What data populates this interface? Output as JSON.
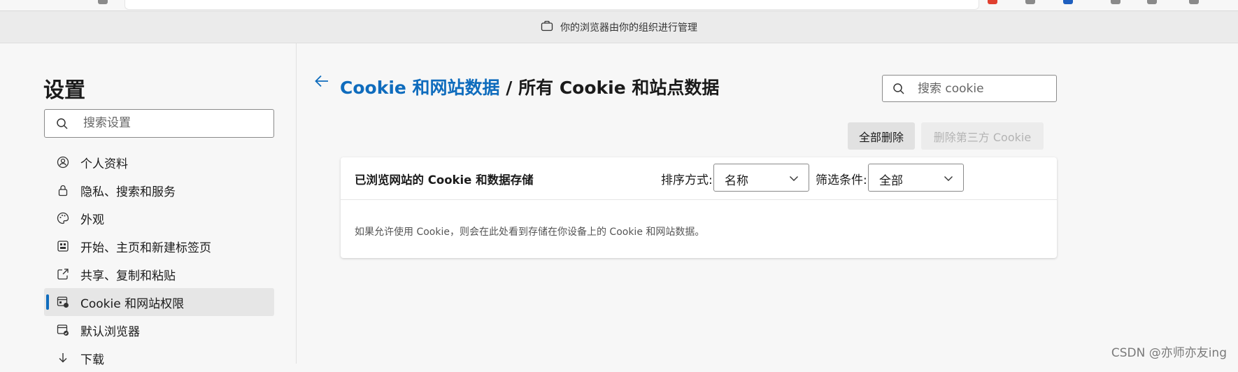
{
  "infobar": {
    "text": "你的浏览器由你的组织进行管理"
  },
  "sidebar": {
    "title": "设置",
    "search_placeholder": "搜索设置",
    "items": [
      {
        "label": "个人资料",
        "icon": "profile-icon"
      },
      {
        "label": "隐私、搜索和服务",
        "icon": "lock-icon"
      },
      {
        "label": "外观",
        "icon": "palette-icon"
      },
      {
        "label": "开始、主页和新建标签页",
        "icon": "homepage-icon"
      },
      {
        "label": "共享、复制和粘贴",
        "icon": "share-icon"
      },
      {
        "label": "Cookie 和网站权限",
        "icon": "site-permissions-icon",
        "active": true
      },
      {
        "label": "默认浏览器",
        "icon": "default-browser-icon"
      },
      {
        "label": "下载",
        "icon": "download-icon"
      }
    ]
  },
  "main": {
    "breadcrumb_link": "Cookie 和网站数据",
    "breadcrumb_sep": " / ",
    "breadcrumb_current": "所有 Cookie 和站点数据",
    "search_placeholder": "搜索 cookie",
    "delete_all_label": "全部删除",
    "delete_third_party_label": "删除第三方 Cookie",
    "card": {
      "title": "已浏览网站的 Cookie 和数据存储",
      "sort_label": "排序方式:",
      "sort_value": "名称",
      "filter_label": "筛选条件:",
      "filter_value": "全部",
      "empty_message": "如果允许使用 Cookie，则会在此处看到存储在你设备上的 Cookie 和网站数据。"
    }
  },
  "watermark": "CSDN @亦师亦友ing",
  "colors": {
    "accent": "#0f6cbd",
    "active_bg": "#e6e6e6"
  }
}
